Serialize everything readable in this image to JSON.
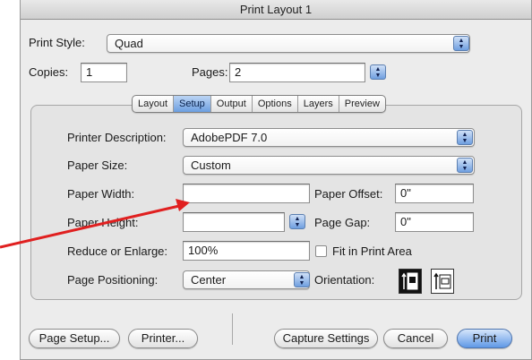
{
  "window": {
    "title": "Print Layout 1"
  },
  "print_style": {
    "label": "Print Style:",
    "value": "Quad"
  },
  "copies": {
    "label": "Copies:",
    "value": "1"
  },
  "pages": {
    "label": "Pages:",
    "value": "2"
  },
  "tabs": [
    {
      "label": "Layout",
      "active": false
    },
    {
      "label": "Setup",
      "active": true
    },
    {
      "label": "Output",
      "active": false
    },
    {
      "label": "Options",
      "active": false
    },
    {
      "label": "Layers",
      "active": false
    },
    {
      "label": "Preview",
      "active": false
    }
  ],
  "setup": {
    "printer_description": {
      "label": "Printer Description:",
      "value": "AdobePDF 7.0"
    },
    "paper_size": {
      "label": "Paper Size:",
      "value": "Custom"
    },
    "paper_width": {
      "label": "Paper Width:",
      "value": ""
    },
    "paper_offset": {
      "label": "Paper Offset:",
      "value": "0\""
    },
    "paper_height": {
      "label": "Paper Height:",
      "value": ""
    },
    "page_gap": {
      "label": "Page Gap:",
      "value": "0\""
    },
    "reduce_enlarge": {
      "label": "Reduce or Enlarge:",
      "value": "100%"
    },
    "fit_in_print_area": {
      "label": "Fit in Print Area",
      "checked": false
    },
    "page_positioning": {
      "label": "Page Positioning:",
      "value": "Center"
    },
    "orientation": {
      "label": "Orientation:",
      "options": [
        "portrait-icon",
        "landscape-icon"
      ],
      "selected": "portrait-icon"
    }
  },
  "buttons": {
    "page_setup": "Page Setup...",
    "printer": "Printer...",
    "capture_settings": "Capture Settings",
    "cancel": "Cancel",
    "print": "Print"
  },
  "annotation": {
    "arrow_color": "#e02020"
  },
  "colors": {
    "accent": "#6c9ee0",
    "window_bg": "#ececec"
  }
}
